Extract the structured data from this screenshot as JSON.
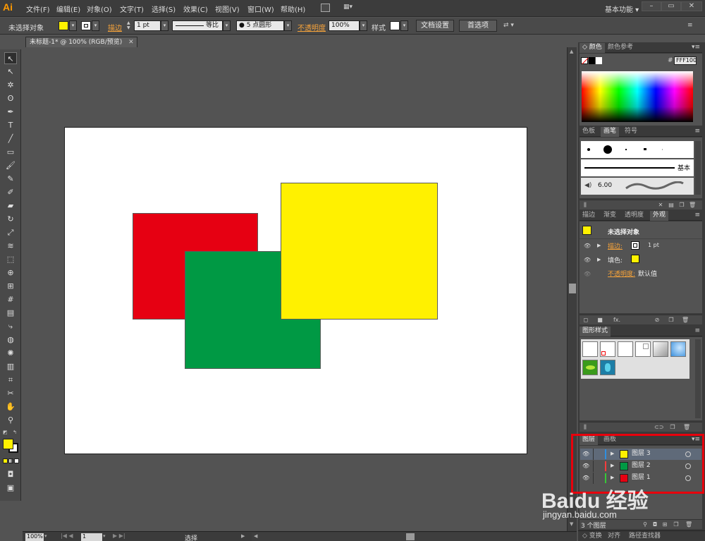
{
  "app": {
    "logo": "Ai",
    "workspace": "基本功能"
  },
  "menu": [
    "文件(F)",
    "编辑(E)",
    "对象(O)",
    "文字(T)",
    "选择(S)",
    "效果(C)",
    "视图(V)",
    "窗口(W)",
    "帮助(H)"
  ],
  "controlbar": {
    "no_selection": "未选择对象",
    "stroke_label": "描边",
    "stroke_weight": "1 pt",
    "stroke_profile": "等比",
    "brush": "● 5 点圆形",
    "opacity_label": "不透明度",
    "opacity_value": "100%",
    "style_label": "样式",
    "doc_setup": "文档设置",
    "preferences": "首选项"
  },
  "document": {
    "tab_title": "未标题-1* @ 100% (RGB/预览)"
  },
  "artwork": {
    "shapes": [
      {
        "name": "red-rectangle",
        "color": "#e60012"
      },
      {
        "name": "green-rectangle",
        "color": "#009944"
      },
      {
        "name": "yellow-rectangle",
        "color": "#fff100"
      }
    ]
  },
  "status": {
    "zoom": "100%",
    "page": "1",
    "tool": "选择"
  },
  "color_panel": {
    "tabs": [
      "颜色",
      "颜色参考"
    ],
    "hex_label": "#",
    "hex_value": "FFF100"
  },
  "brushes_panel": {
    "tabs": [
      "色板",
      "画笔",
      "符号"
    ],
    "basic_label": "基本",
    "size": "6.00"
  },
  "appearance_panel": {
    "tabs": [
      "描边",
      "渐变",
      "透明度",
      "外观"
    ],
    "title": "未选择对象",
    "stroke_label": "描边:",
    "stroke_value": "1 pt",
    "fill_label": "填色:",
    "opacity_label": "不透明度:",
    "opacity_value": "默认值"
  },
  "graphic_styles_panel": {
    "tabs": [
      "图形样式"
    ]
  },
  "layers_panel": {
    "tabs": [
      "图层",
      "画板"
    ],
    "layers": [
      {
        "name": "图层 3",
        "color": "#fff100",
        "bar": "#2f8fe0"
      },
      {
        "name": "图层 2",
        "color": "#009944",
        "bar": "#ff3c3c"
      },
      {
        "name": "图层 1",
        "color": "#e60012",
        "bar": "#37c837"
      }
    ],
    "count": "3 个图层"
  },
  "bottom_tabs": [
    "变换",
    "对齐",
    "路径查找器"
  ],
  "watermark": {
    "brand": "Baidu 经验",
    "url": "jingyan.baidu.com"
  },
  "colors": {
    "fill": "#fff100",
    "accent": "#f6a33a",
    "highlight": "#e8000c"
  }
}
